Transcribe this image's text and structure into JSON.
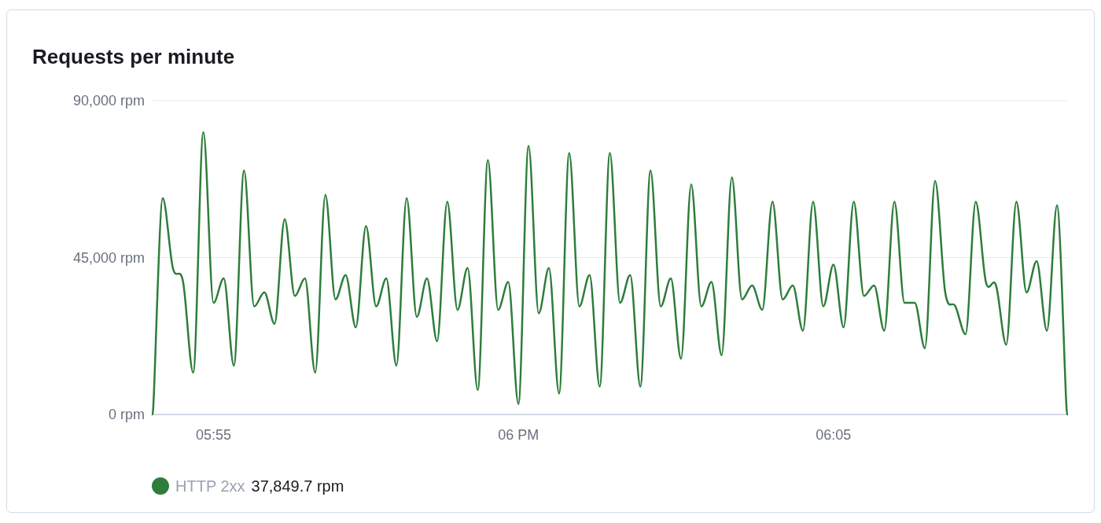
{
  "chart": {
    "chart_data": {
      "type": "line",
      "title": "Requests per minute",
      "categories": [
        null,
        null,
        null,
        null,
        null,
        null,
        "05:55",
        null,
        null,
        null,
        null,
        null,
        null,
        null,
        null,
        null,
        null,
        null,
        null,
        null,
        null,
        null,
        null,
        null,
        null,
        null,
        null,
        null,
        null,
        null,
        null,
        null,
        null,
        null,
        null,
        null,
        "06 PM",
        null,
        null,
        null,
        null,
        null,
        null,
        null,
        null,
        null,
        null,
        null,
        null,
        null,
        null,
        null,
        null,
        null,
        null,
        null,
        null,
        null,
        null,
        null,
        null,
        null,
        null,
        null,
        null,
        null,
        null,
        "06:05",
        null,
        null,
        null,
        null,
        null,
        null,
        null,
        null,
        null,
        null,
        null,
        null,
        null,
        null,
        null,
        null,
        null,
        null,
        null,
        null,
        null,
        null,
        null
      ],
      "series": [
        {
          "name": "HTTP 2xx",
          "color": "#2e7d3b",
          "values": [
            0,
            62000,
            42000,
            38000,
            12000,
            81000,
            32000,
            39000,
            14000,
            70000,
            31000,
            35000,
            26000,
            56000,
            34000,
            39000,
            12000,
            63000,
            33000,
            40000,
            25000,
            54000,
            31000,
            39000,
            14000,
            62000,
            28000,
            39000,
            21000,
            61000,
            30000,
            42000,
            7000,
            73000,
            30000,
            38000,
            3000,
            77000,
            29000,
            42000,
            6000,
            75000,
            31000,
            40000,
            8000,
            75000,
            32000,
            40000,
            8000,
            70000,
            31000,
            39000,
            16000,
            66000,
            31000,
            38000,
            17000,
            68000,
            33000,
            37000,
            30000,
            61000,
            33000,
            37000,
            24000,
            61000,
            31000,
            43000,
            25000,
            61000,
            34000,
            37000,
            24000,
            61000,
            32000,
            32000,
            19000,
            67000,
            35000,
            31000,
            23000,
            61000,
            38000,
            37000,
            20000,
            61000,
            35000,
            44000,
            24000,
            60000,
            0
          ]
        }
      ],
      "ylim": [
        0,
        90000
      ],
      "yticks": [
        {
          "value": 0,
          "label": "0 rpm"
        },
        {
          "value": 45000,
          "label": "45,000 rpm"
        },
        {
          "value": 90000,
          "label": "90,000 rpm"
        }
      ]
    },
    "legend_value": "37,849.7 rpm"
  }
}
